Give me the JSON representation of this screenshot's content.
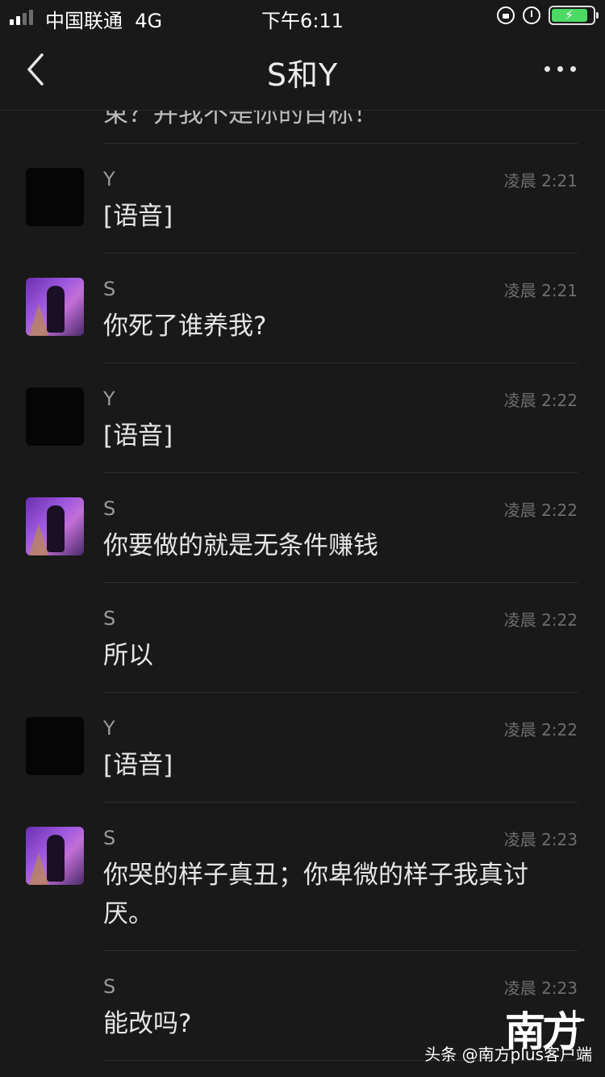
{
  "status_bar": {
    "carrier": "中国联通",
    "network": "4G",
    "time": "下午6:11",
    "signal_bars": 4,
    "signal_bars_active": 2,
    "battery_color": "#4cd964"
  },
  "nav": {
    "title": "S和Y",
    "back_icon": "chevron-left-icon",
    "more_icon": "more-dots-icon"
  },
  "chat": {
    "partial_top_text": "束？并我不是你的目标！",
    "messages": [
      {
        "sender": "Y",
        "time": "凌晨 2:21",
        "text": "[语音]",
        "avatar": "dark"
      },
      {
        "sender": "S",
        "time": "凌晨 2:21",
        "text": "你死了谁养我?",
        "avatar": "photo"
      },
      {
        "sender": "Y",
        "time": "凌晨 2:22",
        "text": "[语音]",
        "avatar": "dark"
      },
      {
        "sender": "S",
        "time": "凌晨 2:22",
        "text": "你要做的就是无条件赚钱",
        "avatar": "photo"
      },
      {
        "sender": "S",
        "time": "凌晨 2:22",
        "text": "所以",
        "avatar": "none"
      },
      {
        "sender": "Y",
        "time": "凌晨 2:22",
        "text": "[语音]",
        "avatar": "dark"
      },
      {
        "sender": "S",
        "time": "凌晨 2:23",
        "text": "你哭的样子真丑；你卑微的样子我真讨厌。",
        "avatar": "photo"
      },
      {
        "sender": "S",
        "time": "凌晨 2:23",
        "text": "能改吗?",
        "avatar": "none"
      }
    ]
  },
  "watermark": {
    "logo": "南方",
    "plus": "+",
    "text": "头条 @南方plus客户端"
  },
  "colors": {
    "background": "#191919",
    "divider": "#303030",
    "time_text": "#6e6e6e"
  }
}
